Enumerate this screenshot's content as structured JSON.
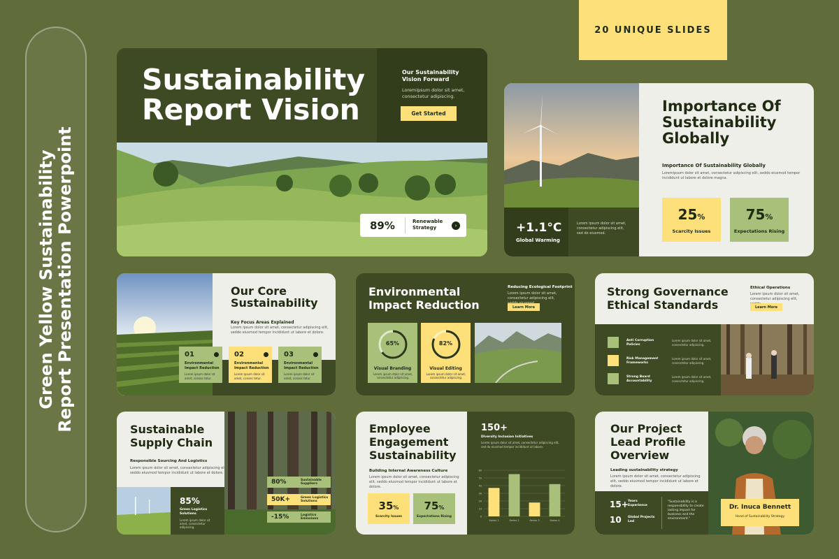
{
  "side_title": [
    "Green Yellow Sustainability",
    "Report Presentation Powerpoint"
  ],
  "badge": "20 UNIQUE SLIDES",
  "slide1": {
    "title_line1": "Sustainability",
    "title_line2": "Report Vision",
    "vision_heading": "Our Sustainability Vision Forward",
    "vision_body": "Loremipsum dolor sit amet, consectetur adipiscing.",
    "button": "Get Started",
    "stat_value": "89%",
    "stat_label": "Renewable Strategy"
  },
  "slide2": {
    "title": "Importance Of Sustainability Globally",
    "subheading": "Importance Of Sustainability Globally",
    "body": "Loremipsum dolor sit amet, consectetur adipiscing elit, seddo eiusmod tempor incididunt ut labore et dolore magna.",
    "temp_value": "+1.1°C",
    "temp_label": "Global Warming",
    "temp_body": "Lorem ipsum dolor sit amet, consectetur adipiscing elit, sed do eiusmod.",
    "stats": [
      {
        "value": "25",
        "unit": "%",
        "label": "Scarcity Issues",
        "color": "#fde07a"
      },
      {
        "value": "75",
        "unit": "%",
        "label": "Expectations Rising",
        "color": "#a9c07a"
      }
    ]
  },
  "slide3": {
    "title": "Our Core Sustainability",
    "subheading": "Key Focus Areas Explained",
    "body": "Lorem ipsum dolor sit amet, consectetur adipiscing elit, seddo eiusmod tempor incididunt ut labore et dolore.",
    "items": [
      {
        "num": "01",
        "label": "Environmental Impact Reduction",
        "body": "Lorem ipsum dolor sit amet, consec tetur."
      },
      {
        "num": "02",
        "label": "Environmental Impact Reduction",
        "body": "Lorem ipsum dolor sit amet, consec tetur."
      },
      {
        "num": "03",
        "label": "Environmental Impact Reduction",
        "body": "Lorem ipsum dolor sit amet, consec tetur."
      }
    ]
  },
  "slide4": {
    "title": "Environmental Impact Reduction",
    "subheading": "Reducing Ecological Footprint",
    "body": "Lorem ipsum dolor sit amet, consectetur adipiscing elit, seddo eiusmod.",
    "button": "Learn More",
    "gauges": [
      {
        "value": "65%",
        "fraction": 0.65,
        "label": "Visual Branding",
        "body": "Lorem ipsum dolor sit amet, consectetur adipiscing."
      },
      {
        "value": "82%",
        "fraction": 0.82,
        "label": "Visual Editing",
        "body": "Lorem ipsum dolor sit amet, consectetur adipiscing."
      }
    ]
  },
  "slide5": {
    "title_line1": "Strong Governance",
    "title_line2": "Ethical Standards",
    "subheading": "Ethical Operations",
    "body": "Lorem ipsum dolor sit amet, consectetur adipiscing elit, seddo.",
    "button": "Learn More",
    "items": [
      {
        "label": "Anti Corruption Policies",
        "body": "Lorem ipsum dolor sit amet, consectetur adipiscing."
      },
      {
        "label": "Risk Management Frameworks",
        "body": "Lorem ipsum dolor sit amet, consectetur adipiscing."
      },
      {
        "label": "Strong Board Accountability",
        "body": "Lorem ipsum dolor sit amet, consectetur adipiscing."
      }
    ]
  },
  "slide6": {
    "title": "Sustainable Supply Chain",
    "subheading": "Responsible Sourcing And Logistics",
    "body": "Lorem ipsum dolor sit amet, consectetur adipiscing elit, seddo eiusmod tempor incididunt ut labore et dolore.",
    "stat_value": "85%",
    "stat_label": "Green Logistics Solutions",
    "stat_body": "Lorem ipsum dolor sit amet, consectetur adipiscing.",
    "rows": [
      {
        "value": "80%",
        "label": "Sustainable Suppliers"
      },
      {
        "value": "50K+",
        "label": "Green Logistics Solutions"
      },
      {
        "value": "-15%",
        "label": "Logistics Emissions"
      }
    ]
  },
  "slide7": {
    "title": "Employee Engagement Sustainability",
    "subheading": "Building Internal Awareness Culture",
    "body": "Lorem ipsum dolor sit amet, consectetur adipiscing elit, seddo eiusmod tempor incididunt ut labore et dolore.",
    "stat_value": "150+",
    "stat_label": "Diversity Inclusion Initiatives",
    "stat_body": "Lorem ipsum dolor sit amet, consectetur adipiscing elit, sed do eiusmod tempor incididunt ut labore.",
    "stats": [
      {
        "value": "35",
        "unit": "%",
        "label": "Scarcity Issues"
      },
      {
        "value": "75",
        "unit": "%",
        "label": "Expectations Rising"
      }
    ]
  },
  "chart_data": {
    "type": "bar",
    "categories": [
      "Series 1",
      "Series 2",
      "Series 3",
      "Series 4"
    ],
    "values": [
      37,
      55,
      18,
      42
    ],
    "colors": [
      "#fde07a",
      "#a9c07a",
      "#fde07a",
      "#a9c07a"
    ],
    "ylim": [
      0,
      60
    ],
    "yticks": [
      "60",
      "50",
      "40",
      "30",
      "20",
      "10",
      "0"
    ],
    "title": "",
    "grid": true
  },
  "slide8": {
    "title": "Our Project Lead Profile Overview",
    "subheading": "Leading sustainability strategy",
    "body": "Lorem ipsum dolor sit amet, consectetur adipiscing elit, seddo eiusmod tempor incididunt ut labore et dolore.",
    "stats": [
      {
        "value": "15+",
        "label": "Years Experience"
      },
      {
        "value": "10",
        "label": "Global Projects Led"
      }
    ],
    "quote": "\"Sustainability is a responsibility to create lasting impact for business and the environment.\"",
    "name": "Dr. Inuca Bennett",
    "role": "Head of Sustainability Strategy"
  },
  "colors": {
    "background": "#606c3a",
    "dark_green": "#3e4a24",
    "yellow": "#fde07a",
    "sage": "#a9c07a",
    "light": "#eeefe9"
  }
}
